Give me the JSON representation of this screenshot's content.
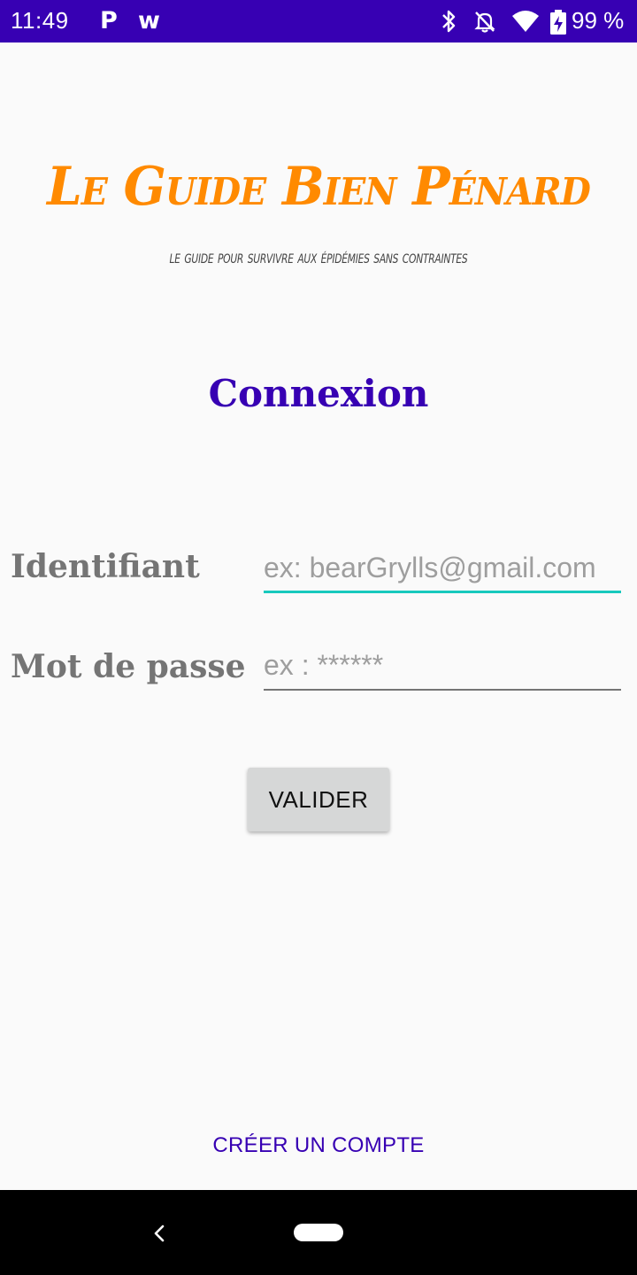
{
  "status_bar": {
    "time": "11:49",
    "notification_p": "P",
    "notification_w": "w",
    "battery": "99 %"
  },
  "app": {
    "title": "Le Guide Bien Pénard",
    "subtitle": "le guide pour survivre aux épidémies sans contraintes"
  },
  "login": {
    "title": "Connexion",
    "username_label": "Identifiant",
    "username_placeholder": "ex: bearGrylls@gmail.com",
    "password_label": "Mot de passe",
    "password_placeholder": "ex : ******",
    "submit_label": "VALIDER",
    "create_account_label": "CRÉER UN COMPTE"
  },
  "colors": {
    "status_bar": "#3700b3",
    "accent": "#3700b3",
    "title_orange": "#ff8a00",
    "focus_underline": "#18c9bd"
  },
  "icons": [
    "bluetooth-icon",
    "notifications-off-icon",
    "wifi-icon",
    "battery-charging-icon",
    "back-icon",
    "home-icon"
  ]
}
